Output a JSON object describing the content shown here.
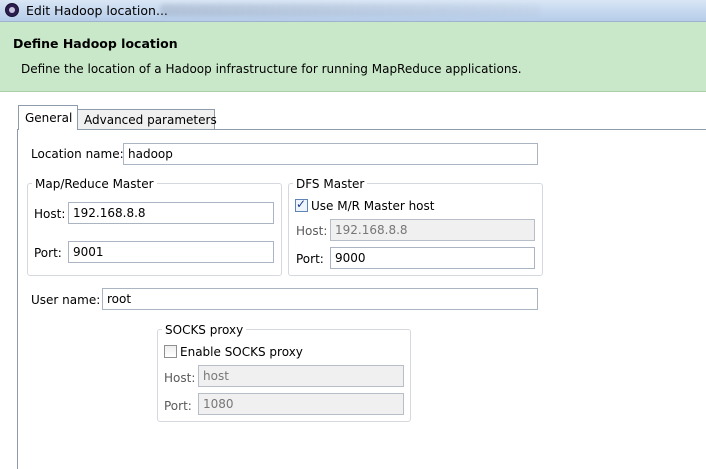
{
  "window": {
    "title": "Edit Hadoop location..."
  },
  "banner": {
    "title": "Define Hadoop location",
    "description": "Define the location of a Hadoop infrastructure for running MapReduce applications."
  },
  "tabs": [
    {
      "label": "General",
      "selected": true
    },
    {
      "label": "Advanced parameters",
      "selected": false
    }
  ],
  "general": {
    "location_name_label": "Location name:",
    "location_name_value": "hadoop",
    "mapred_master": {
      "title": "Map/Reduce Master",
      "host_label": "Host:",
      "host_value": "192.168.8.8",
      "port_label": "Port:",
      "port_value": "9001"
    },
    "dfs_master": {
      "title": "DFS Master",
      "use_mr_host_label": "Use M/R Master host",
      "use_mr_host_checked": true,
      "host_label": "Host:",
      "host_value": "192.168.8.8",
      "port_label": "Port:",
      "port_value": "9000"
    },
    "user_name_label": "User name:",
    "user_name_value": "root",
    "socks_proxy": {
      "title": "SOCKS proxy",
      "enable_label": "Enable SOCKS proxy",
      "enable_checked": false,
      "host_label": "Host:",
      "host_value": "host",
      "port_label": "Port:",
      "port_value": "1080"
    }
  },
  "colors": {
    "banner_bg": "#c9e8c9",
    "titlebar_bg": "#c3d6ee"
  }
}
